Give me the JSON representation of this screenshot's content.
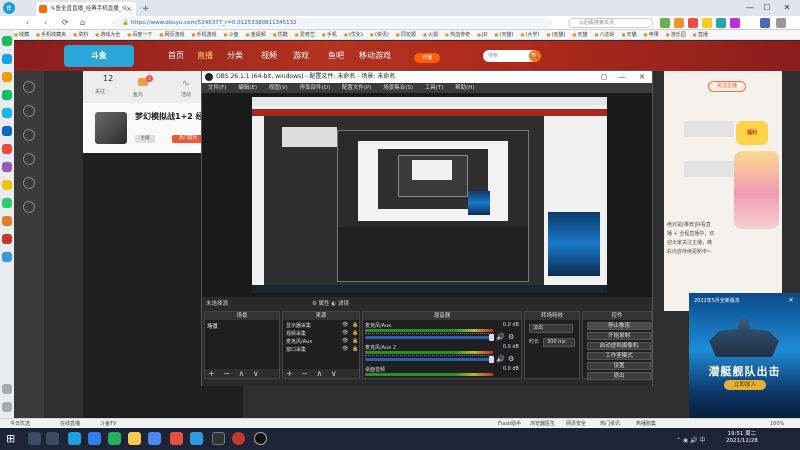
{
  "browser": {
    "tab_title": "斗鱼全直直播_经典手机直播_斗...",
    "tab_close": "×",
    "new_tab": "+",
    "url_lock": "🔒",
    "url": "https://www.douyu.com/5246377_r=0.01253380811345132",
    "search_placeholder": "以后缀搜索本页",
    "win_controls": [
      "—",
      "☐",
      "✕"
    ],
    "nav": [
      "‹",
      "›",
      "⟳",
      "⌂"
    ]
  },
  "bookmarks": [
    "收藏",
    "手机收藏夹",
    "资料",
    "游戏大全",
    "百度一下",
    "网页游戏",
    "手机游戏",
    "斗鱼",
    "金视频",
    "优酷",
    "爱奇艺",
    "手机",
    "(优化)",
    "(资讯)",
    "同花顺",
    "火狐",
    "热血传奇",
    "JD",
    "(天猫)",
    "(大学)",
    "(天猫)",
    "天猫",
    "八达岭",
    "天猫",
    "苹果",
    "游乐园",
    "直播"
  ],
  "site": {
    "logo_text": "斗鱼",
    "nav": [
      "首页",
      "直播",
      "分类",
      "视频",
      "游戏",
      "鱼吧",
      "移动游戏"
    ],
    "search_placeholder": "搜索",
    "search_btn": "🔍",
    "open_live": "开播"
  },
  "stream": {
    "stat_count": "12",
    "stat_count_label": "关注",
    "stat_badge": "2",
    "stat_label_b": "鱼丸",
    "stat_icon_c": "∿",
    "stat_label_c": "活动",
    "room_title": "梦幻模拟战1+2 经典",
    "room_tag": "主播",
    "room_tag2": "热门游戏"
  },
  "right_panel": {
    "follow": "关注主播",
    "text": "绝对是[推荐]好看直播 + 全程直播中，欢迎大家关注主播，精彩内容持续更新中~",
    "ad_badge": "福利"
  },
  "obs": {
    "title": "OBS 26.1.1 (64-bit, windows) - 配置文件: 未命名 - 场景: 未命名",
    "menu": [
      "文件(F)",
      "编辑(E)",
      "视图(V)",
      "停靠部件(D)",
      "配置文件(P)",
      "场景集合(S)",
      "工具(T)",
      "帮助(H)"
    ],
    "win_controls": [
      "▢",
      "—",
      "☐",
      "✕"
    ],
    "scene_label": "未选择源",
    "studio_btns": "⚙ 属性   ◐ 滤镜",
    "docks": {
      "scenes": "场景",
      "sources": "来源",
      "mixer": "混音器",
      "transitions": "转场特效",
      "controls": "控件"
    },
    "scenes": [
      "场景"
    ],
    "sources": [
      "显示器采集",
      "视频采集",
      "麦克风/Aux",
      "窗口采集"
    ],
    "source_eye": "👁",
    "source_lock": "🔒",
    "mixer": [
      {
        "name": "麦克风/Aux",
        "db": "0.0 dB"
      },
      {
        "name": "麦克风/Aux 2",
        "db": "0.0 dB"
      },
      {
        "name": "桌面音频",
        "db": "0.0 dB"
      }
    ],
    "mixer_vol": "🔊",
    "mixer_gear": "⚙",
    "transition_type": "淡出",
    "duration_label": "时长",
    "duration_value": "300 ms",
    "controls": [
      "停止推流",
      "开始录制",
      "启动虚拟摄像机",
      "工作室模式",
      "设置",
      "退出"
    ],
    "dock_foot": "+ − ∧ ∨"
  },
  "float_ad": {
    "title": "2022年5月全新版本",
    "close": "×",
    "headline": "潜艇舰队出击",
    "cta": "立即加入"
  },
  "statusbar": {
    "left": "今日优选",
    "mid1": "在线直播",
    "mid2": "斗鱼TV",
    "items": [
      "Flash助手",
      "浏览器医生",
      "网页安全",
      "热门资讯",
      "热播剧集",
      "100%"
    ]
  },
  "taskbar": {
    "start": "⊞",
    "time": "19:51 周二",
    "date": "2021/12/28",
    "tray": "⌃ ◉ 🔊 中"
  },
  "colors": {
    "accent_orange": "#ff6a00",
    "site_red": "#a8281b",
    "obs_dark": "#2a2a2a"
  }
}
